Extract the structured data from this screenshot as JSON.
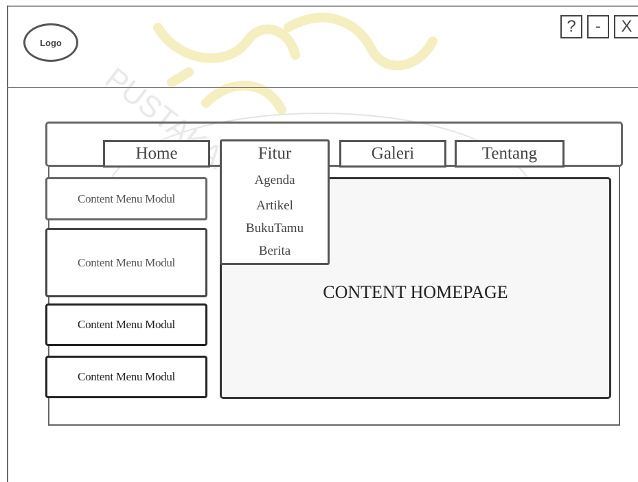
{
  "header": {
    "logo_text": "Logo",
    "window_controls": {
      "help": "?",
      "minimize": "-",
      "close": "X"
    }
  },
  "nav": {
    "tabs": [
      {
        "label": "Home"
      },
      {
        "label": "Fitur"
      },
      {
        "label": "Galeri"
      },
      {
        "label": "Tentang"
      }
    ],
    "dropdown_items": [
      "Agenda",
      "Artikel",
      "BukuTamu",
      "Berita"
    ]
  },
  "sidebar": {
    "modules": [
      {
        "label": "Content Menu Modul"
      },
      {
        "label": "Content Menu Modul"
      },
      {
        "label": "Content Menu Modul"
      },
      {
        "label": "Content Menu Modul"
      }
    ]
  },
  "main": {
    "title": "CONTENT HOMEPAGE"
  },
  "colors": {
    "line": "#555555",
    "content_bg": "#f7f7f7",
    "watermark": "#f2e7a0"
  }
}
